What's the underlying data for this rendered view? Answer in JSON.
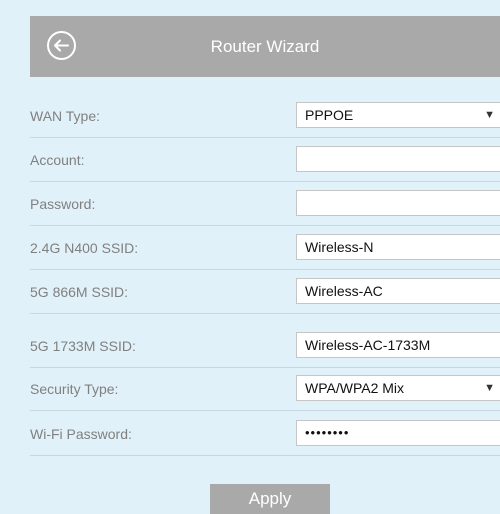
{
  "header": {
    "title": "Router Wizard",
    "back_icon": "back-arrow-circle-icon"
  },
  "form": {
    "wan_type": {
      "label": "WAN Type:",
      "value": "PPPOE"
    },
    "account": {
      "label": "Account:",
      "value": ""
    },
    "password": {
      "label": "Password:",
      "value": ""
    },
    "ssid_24g": {
      "label": "2.4G N400 SSID:",
      "value": "Wireless-N"
    },
    "ssid_5g_866": {
      "label": "5G 866M SSID:",
      "value": "Wireless-AC"
    },
    "ssid_5g_1733": {
      "label": "5G 1733M SSID:",
      "value": "Wireless-AC-1733M"
    },
    "security_type": {
      "label": "Security Type:",
      "value": "WPA/WPA2 Mix"
    },
    "wifi_password": {
      "label": "Wi-Fi Password:",
      "value": "••••••••"
    }
  },
  "actions": {
    "apply_label": "Apply"
  },
  "colors": {
    "background": "#e1f1f9",
    "header": "#a9a9a9",
    "label_text": "#808080",
    "divider": "#c7d8e0"
  }
}
